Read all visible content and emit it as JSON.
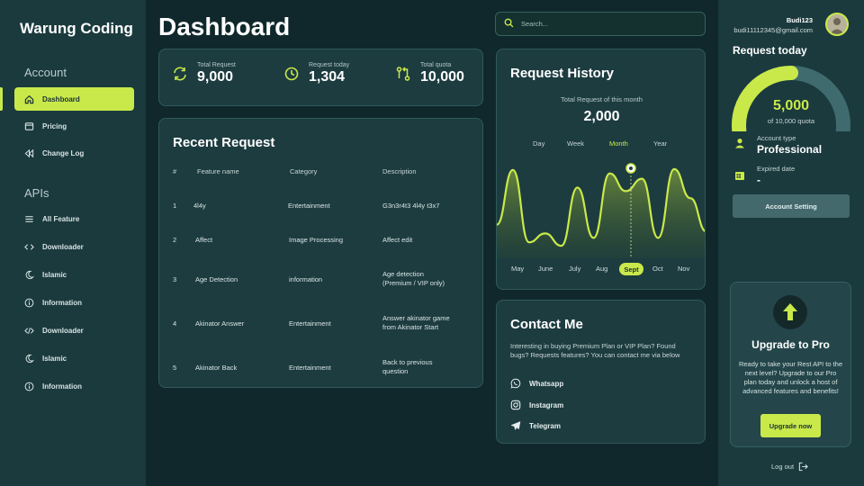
{
  "brand": "Warung Coding",
  "sidebar": {
    "account_title": "Account",
    "account_items": [
      {
        "label": "Dashboard"
      },
      {
        "label": "Pricing"
      },
      {
        "label": "Change Log"
      }
    ],
    "apis_title": "APIs",
    "api_items": [
      {
        "label": "All Feature"
      },
      {
        "label": "Downloader"
      },
      {
        "label": "Islamic"
      },
      {
        "label": "Information"
      },
      {
        "label": "Downloader"
      },
      {
        "label": "Islamic"
      },
      {
        "label": "Information"
      }
    ]
  },
  "header": {
    "title": "Dashboard",
    "search_placeholder": "Search..."
  },
  "stats": [
    {
      "label": "Total Request",
      "value": "9,000"
    },
    {
      "label": "Request today",
      "value": "1,304"
    },
    {
      "label": "Total quota",
      "value": "10,000"
    }
  ],
  "recent": {
    "title": "Recent Request",
    "columns": [
      "#",
      "Feature name",
      "Category",
      "Description"
    ],
    "rows": [
      {
        "num": "1",
        "feature": "4l4y",
        "category": "Entertainment",
        "desc": "G3n3r4t3 4l4y t3x7"
      },
      {
        "num": "2",
        "feature": "Affect",
        "category": "Image Processing",
        "desc": "Affect edit"
      },
      {
        "num": "3",
        "feature": "Age Detection",
        "category": "information",
        "desc": "Age detection\n(Premium / VIP only)"
      },
      {
        "num": "4",
        "feature": "Akinator Answer",
        "category": "Entertainment",
        "desc": "Answer akinator game\nfrom Akinator Start"
      },
      {
        "num": "5",
        "feature": "Akinator Back",
        "category": "Entertainment",
        "desc": "Back to previous\nquestion"
      }
    ]
  },
  "history": {
    "title": "Request History",
    "subtitle": "Total Request of this month",
    "total": "2,000",
    "timeframes": [
      "Day",
      "Week",
      "Month",
      "Year"
    ],
    "active_timeframe": "Month",
    "active_month": "Sept"
  },
  "chart_data": {
    "type": "area",
    "x": [
      "May",
      "June",
      "July",
      "Aug",
      "Sept",
      "Oct",
      "Nov"
    ],
    "series": [
      {
        "values": [
          0.3,
          0.92,
          0.1,
          0.2,
          0.06,
          0.72,
          0.15,
          0.88,
          0.68,
          0.82,
          0.15,
          0.93,
          0.6,
          0.22
        ]
      }
    ],
    "highlight": "Sept",
    "grid": false,
    "legend": "none"
  },
  "contact": {
    "title": "Contact Me",
    "text": "Interesting in buying Premium Plan or VIP Plan? Found bugs? Requests features? You can contact me via below",
    "items": [
      {
        "label": "Whatsapp"
      },
      {
        "label": "Instagram"
      },
      {
        "label": "Telegram"
      }
    ]
  },
  "user": {
    "name": "Budi123",
    "email": "budi11112345@gmail.com"
  },
  "quota": {
    "title": "Request today",
    "value": "5,000",
    "caption": "of 10,000 quota",
    "used": 5000,
    "max": 10000
  },
  "account": {
    "type_label": "Account type",
    "type_value": "Professional",
    "expired_label": "Expired date",
    "expired_value": "-",
    "setting_label": "Account Setting"
  },
  "upgrade": {
    "title": "Upgrade to Pro",
    "text": "Ready to take your Rest API to the next level? Upgrade to our Pro plan today and unlock a host of advanced features and benefits!",
    "button": "Upgrade now"
  },
  "logout": "Log out",
  "colors": {
    "accent": "#c9e94a",
    "panel": "#1d3c40",
    "bg": "#10282c"
  }
}
